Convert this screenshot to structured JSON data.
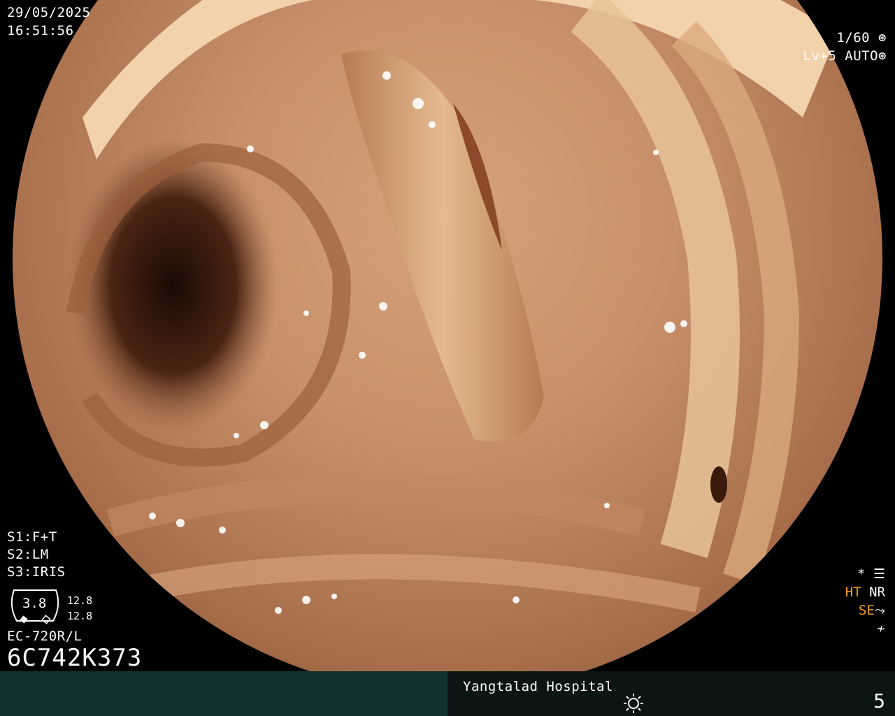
{
  "datetime": {
    "date": "29/05/2025",
    "time": "16:51:56"
  },
  "exposure": {
    "shutter": "1/60",
    "level": "Lv+5",
    "mode": "AUTO"
  },
  "presets": [
    {
      "key": "S1:",
      "value": "F+T"
    },
    {
      "key": "S2:",
      "value": "LM"
    },
    {
      "key": "S3:",
      "value": "IRIS"
    }
  ],
  "gauge": {
    "value": "3.8",
    "upper": "12.8",
    "lower": "12.8"
  },
  "scope": {
    "model": "EC-720R/L",
    "serial": "6C742K373"
  },
  "right_panel": {
    "star": "*",
    "ht": "HT",
    "nr": "NR",
    "se": "SE"
  },
  "footer": {
    "hospital": "Yangtalad Hospital",
    "image_number": "5"
  },
  "icons": [
    "aperture-icon",
    "settings-icon",
    "sun-icon",
    "curve-icon",
    "zigzag-icon"
  ],
  "colors": {
    "accent": "#f0a018",
    "footer_left": "#12302e",
    "footer_right": "#0b1513"
  }
}
